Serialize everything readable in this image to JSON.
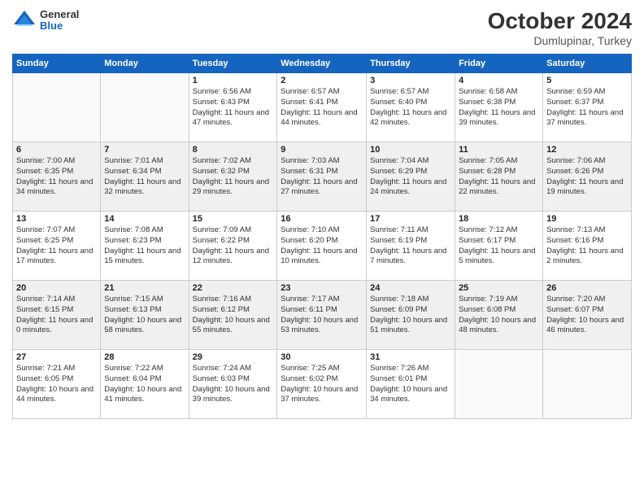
{
  "header": {
    "logo": {
      "general": "General",
      "blue": "Blue"
    },
    "title": "October 2024",
    "location": "Dumlupinar, Turkey"
  },
  "weekdays": [
    "Sunday",
    "Monday",
    "Tuesday",
    "Wednesday",
    "Thursday",
    "Friday",
    "Saturday"
  ],
  "weeks": [
    [
      {
        "day": "",
        "info": ""
      },
      {
        "day": "",
        "info": ""
      },
      {
        "day": "1",
        "info": "Sunrise: 6:56 AM\nSunset: 6:43 PM\nDaylight: 11 hours and 47 minutes."
      },
      {
        "day": "2",
        "info": "Sunrise: 6:57 AM\nSunset: 6:41 PM\nDaylight: 11 hours and 44 minutes."
      },
      {
        "day": "3",
        "info": "Sunrise: 6:57 AM\nSunset: 6:40 PM\nDaylight: 11 hours and 42 minutes."
      },
      {
        "day": "4",
        "info": "Sunrise: 6:58 AM\nSunset: 6:38 PM\nDaylight: 11 hours and 39 minutes."
      },
      {
        "day": "5",
        "info": "Sunrise: 6:59 AM\nSunset: 6:37 PM\nDaylight: 11 hours and 37 minutes."
      }
    ],
    [
      {
        "day": "6",
        "info": "Sunrise: 7:00 AM\nSunset: 6:35 PM\nDaylight: 11 hours and 34 minutes."
      },
      {
        "day": "7",
        "info": "Sunrise: 7:01 AM\nSunset: 6:34 PM\nDaylight: 11 hours and 32 minutes."
      },
      {
        "day": "8",
        "info": "Sunrise: 7:02 AM\nSunset: 6:32 PM\nDaylight: 11 hours and 29 minutes."
      },
      {
        "day": "9",
        "info": "Sunrise: 7:03 AM\nSunset: 6:31 PM\nDaylight: 11 hours and 27 minutes."
      },
      {
        "day": "10",
        "info": "Sunrise: 7:04 AM\nSunset: 6:29 PM\nDaylight: 11 hours and 24 minutes."
      },
      {
        "day": "11",
        "info": "Sunrise: 7:05 AM\nSunset: 6:28 PM\nDaylight: 11 hours and 22 minutes."
      },
      {
        "day": "12",
        "info": "Sunrise: 7:06 AM\nSunset: 6:26 PM\nDaylight: 11 hours and 19 minutes."
      }
    ],
    [
      {
        "day": "13",
        "info": "Sunrise: 7:07 AM\nSunset: 6:25 PM\nDaylight: 11 hours and 17 minutes."
      },
      {
        "day": "14",
        "info": "Sunrise: 7:08 AM\nSunset: 6:23 PM\nDaylight: 11 hours and 15 minutes."
      },
      {
        "day": "15",
        "info": "Sunrise: 7:09 AM\nSunset: 6:22 PM\nDaylight: 11 hours and 12 minutes."
      },
      {
        "day": "16",
        "info": "Sunrise: 7:10 AM\nSunset: 6:20 PM\nDaylight: 11 hours and 10 minutes."
      },
      {
        "day": "17",
        "info": "Sunrise: 7:11 AM\nSunset: 6:19 PM\nDaylight: 11 hours and 7 minutes."
      },
      {
        "day": "18",
        "info": "Sunrise: 7:12 AM\nSunset: 6:17 PM\nDaylight: 11 hours and 5 minutes."
      },
      {
        "day": "19",
        "info": "Sunrise: 7:13 AM\nSunset: 6:16 PM\nDaylight: 11 hours and 2 minutes."
      }
    ],
    [
      {
        "day": "20",
        "info": "Sunrise: 7:14 AM\nSunset: 6:15 PM\nDaylight: 11 hours and 0 minutes."
      },
      {
        "day": "21",
        "info": "Sunrise: 7:15 AM\nSunset: 6:13 PM\nDaylight: 10 hours and 58 minutes."
      },
      {
        "day": "22",
        "info": "Sunrise: 7:16 AM\nSunset: 6:12 PM\nDaylight: 10 hours and 55 minutes."
      },
      {
        "day": "23",
        "info": "Sunrise: 7:17 AM\nSunset: 6:11 PM\nDaylight: 10 hours and 53 minutes."
      },
      {
        "day": "24",
        "info": "Sunrise: 7:18 AM\nSunset: 6:09 PM\nDaylight: 10 hours and 51 minutes."
      },
      {
        "day": "25",
        "info": "Sunrise: 7:19 AM\nSunset: 6:08 PM\nDaylight: 10 hours and 48 minutes."
      },
      {
        "day": "26",
        "info": "Sunrise: 7:20 AM\nSunset: 6:07 PM\nDaylight: 10 hours and 46 minutes."
      }
    ],
    [
      {
        "day": "27",
        "info": "Sunrise: 7:21 AM\nSunset: 6:05 PM\nDaylight: 10 hours and 44 minutes."
      },
      {
        "day": "28",
        "info": "Sunrise: 7:22 AM\nSunset: 6:04 PM\nDaylight: 10 hours and 41 minutes."
      },
      {
        "day": "29",
        "info": "Sunrise: 7:24 AM\nSunset: 6:03 PM\nDaylight: 10 hours and 39 minutes."
      },
      {
        "day": "30",
        "info": "Sunrise: 7:25 AM\nSunset: 6:02 PM\nDaylight: 10 hours and 37 minutes."
      },
      {
        "day": "31",
        "info": "Sunrise: 7:26 AM\nSunset: 6:01 PM\nDaylight: 10 hours and 34 minutes."
      },
      {
        "day": "",
        "info": ""
      },
      {
        "day": "",
        "info": ""
      }
    ]
  ]
}
